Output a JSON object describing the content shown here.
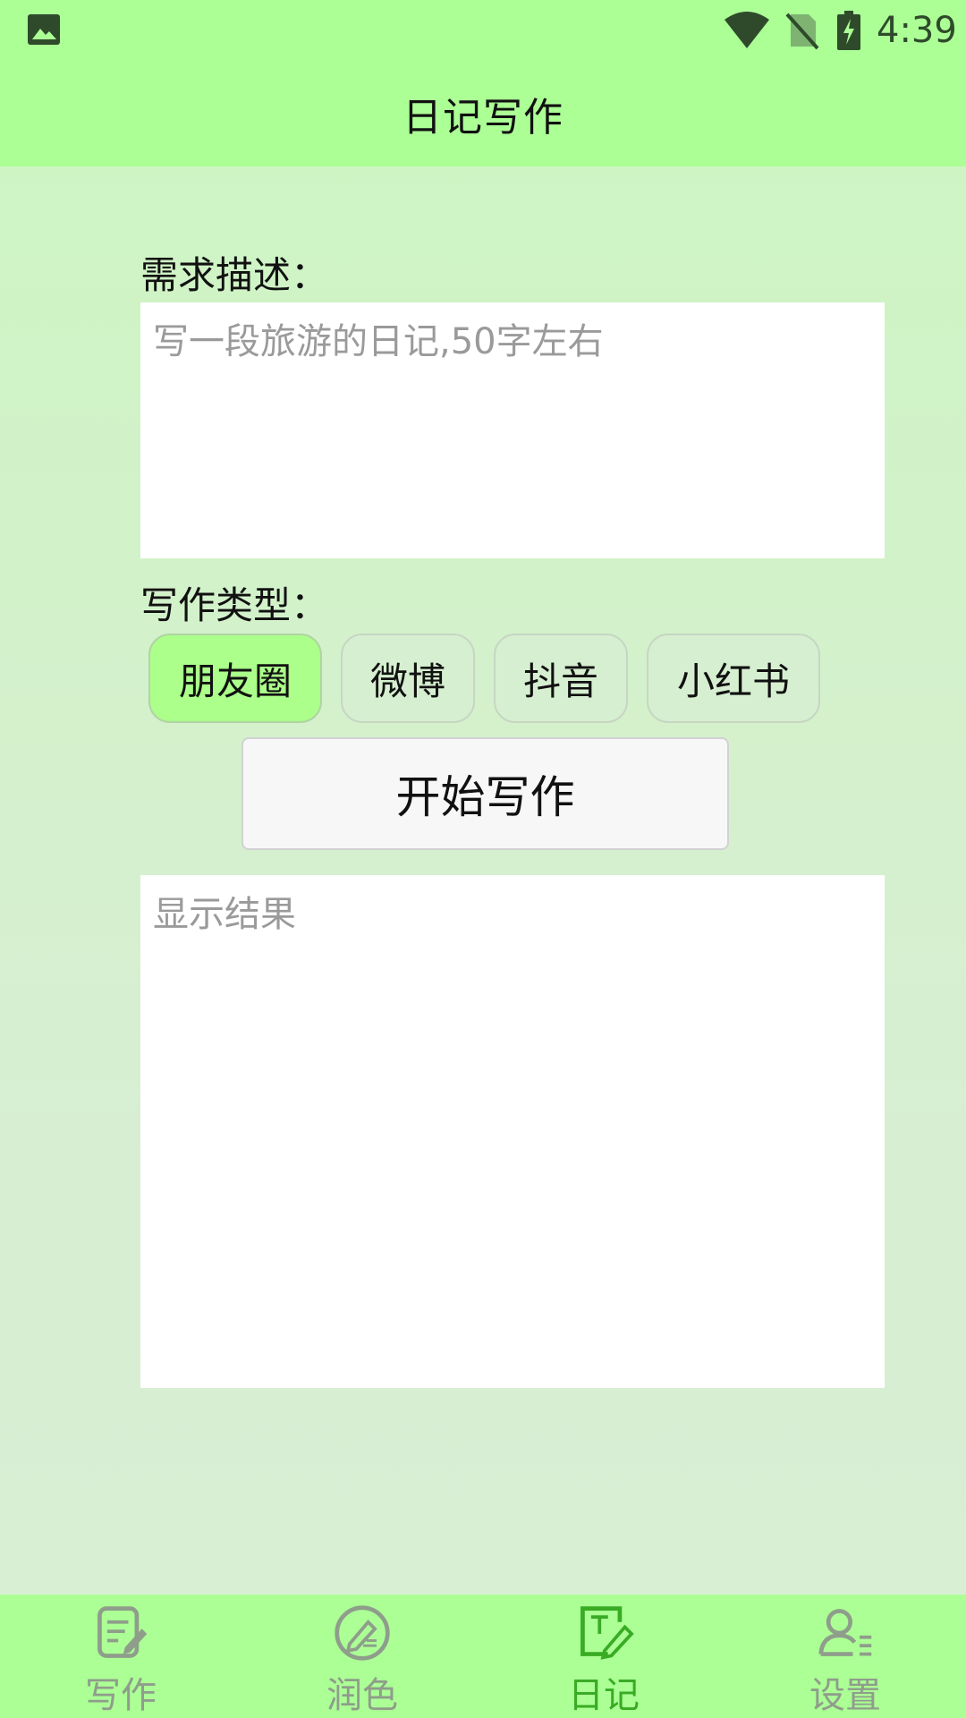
{
  "status_bar": {
    "time": "4:39",
    "icons": [
      "gallery-icon",
      "wifi-icon",
      "no-sim-icon",
      "battery-charging-icon"
    ]
  },
  "header": {
    "title": "日记写作"
  },
  "form": {
    "requirement_label": "需求描述：",
    "requirement_placeholder": "写一段旅游的日记,50字左右",
    "type_label": "写作类型：",
    "types": [
      {
        "label": "朋友圈",
        "selected": true
      },
      {
        "label": "微博",
        "selected": false
      },
      {
        "label": "抖音",
        "selected": false
      },
      {
        "label": "小红书",
        "selected": false
      }
    ],
    "start_button": "开始写作",
    "result_placeholder": "显示结果"
  },
  "bottom_nav": {
    "items": [
      {
        "label": "写作",
        "icon": "document-edit-icon",
        "active": false
      },
      {
        "label": "润色",
        "icon": "polish-icon",
        "active": false
      },
      {
        "label": "日记",
        "icon": "diary-icon",
        "active": true
      },
      {
        "label": "设置",
        "icon": "user-settings-icon",
        "active": false
      }
    ]
  },
  "colors": {
    "accent_green": "#abff95",
    "selected_chip": "#abff8a",
    "active_nav": "#3aab24",
    "inactive_nav": "#8f9d8b"
  }
}
